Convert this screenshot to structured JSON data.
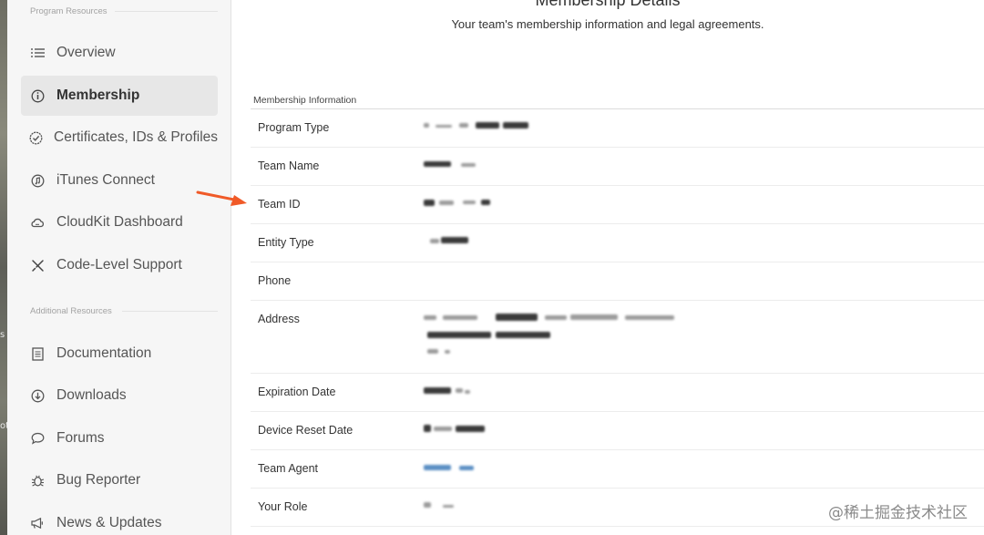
{
  "desktop": {
    "edge_chars": [
      "s",
      "ot"
    ]
  },
  "sidebar": {
    "section_program": "Program Resources",
    "section_additional": "Additional Resources",
    "items": [
      {
        "label": "Overview",
        "icon": "list-icon"
      },
      {
        "label": "Membership",
        "icon": "info-circle-icon",
        "active": true
      },
      {
        "label": "Certificates, IDs & Profiles",
        "icon": "check-badge-icon"
      },
      {
        "label": "iTunes Connect",
        "icon": "itunes-icon"
      },
      {
        "label": "CloudKit Dashboard",
        "icon": "cloud-icon"
      },
      {
        "label": "Code-Level Support",
        "icon": "tools-icon"
      },
      {
        "label": "Documentation",
        "icon": "document-icon"
      },
      {
        "label": "Downloads",
        "icon": "download-icon"
      },
      {
        "label": "Forums",
        "icon": "chat-bubble-icon"
      },
      {
        "label": "Bug Reporter",
        "icon": "bug-icon"
      },
      {
        "label": "News & Updates",
        "icon": "megaphone-icon"
      }
    ]
  },
  "main": {
    "title": "Membership Details",
    "subtitle": "Your team's membership information and legal agreements.",
    "section_label": "Membership Information",
    "rows": [
      {
        "key": "Program Type",
        "value_state": "redacted"
      },
      {
        "key": "Team Name",
        "value_state": "redacted"
      },
      {
        "key": "Team ID",
        "value_state": "redacted",
        "highlighted_by_arrow": true
      },
      {
        "key": "Entity Type",
        "value_state": "redacted"
      },
      {
        "key": "Phone",
        "value_state": "empty"
      },
      {
        "key": "Address",
        "value_state": "redacted"
      },
      {
        "key": "Expiration Date",
        "value_state": "redacted"
      },
      {
        "key": "Device Reset Date",
        "value_state": "redacted"
      },
      {
        "key": "Team Agent",
        "value_state": "redacted-link"
      },
      {
        "key": "Your Role",
        "value_state": "redacted"
      }
    ]
  },
  "annotation": {
    "arrow_color": "#f05a28"
  },
  "watermark": "@稀土掘金技术社区",
  "colors": {
    "sidebar_bg": "#f6f6f6",
    "active_item_bg": "#e7e7e7",
    "link_blue": "#5b8fc4"
  }
}
